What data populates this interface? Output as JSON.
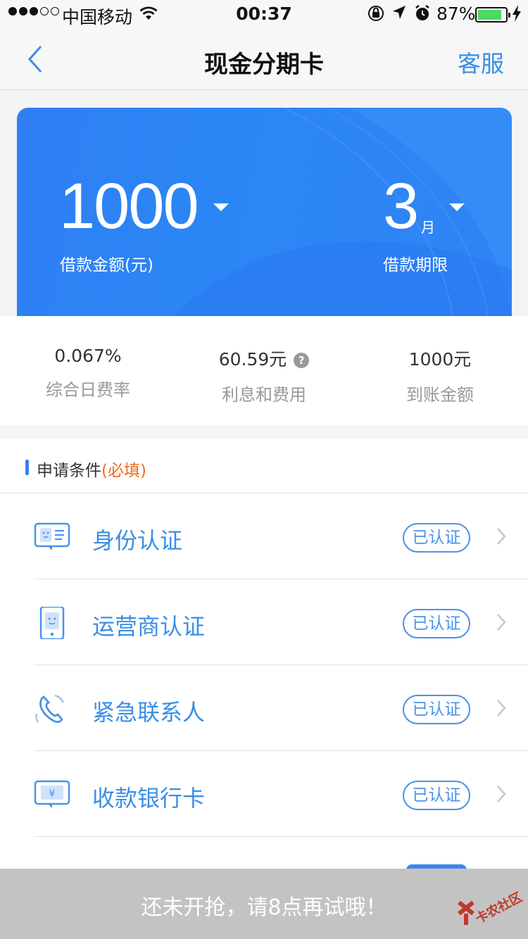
{
  "status_bar": {
    "carrier": "中国移动",
    "time": "00:37",
    "battery": "87%",
    "battery_level": 0.87
  },
  "nav": {
    "title": "现金分期卡",
    "service": "客服"
  },
  "loan": {
    "amount": "1000",
    "amount_label": "借款金额(元)",
    "term": "3",
    "term_unit": "月",
    "term_label": "借款期限"
  },
  "stats": [
    {
      "value": "0.067%",
      "label": "综合日费率"
    },
    {
      "value": "60.59元",
      "label": "利息和费用",
      "help": "?"
    },
    {
      "value": "1000元",
      "label": "到账金额"
    }
  ],
  "requirements": {
    "title": "申请条件",
    "required": "(必填)",
    "items": [
      {
        "label": "身份认证",
        "status": "已认证",
        "icon": "id-card-icon"
      },
      {
        "label": "运营商认证",
        "status": "已认证",
        "icon": "phone-icon"
      },
      {
        "label": "紧急联系人",
        "status": "已认证",
        "icon": "contact-phone-icon"
      },
      {
        "label": "收款银行卡",
        "status": "已认证",
        "icon": "bank-card-icon"
      }
    ]
  },
  "toast": {
    "message": "还未开抢，请8点再试哦！"
  },
  "watermark": "卡农社区",
  "colors": {
    "accent": "#3a8ee6",
    "card_blue": "#2b86f5",
    "required_orange": "#f36b1b",
    "battery_green": "#4cd964"
  }
}
